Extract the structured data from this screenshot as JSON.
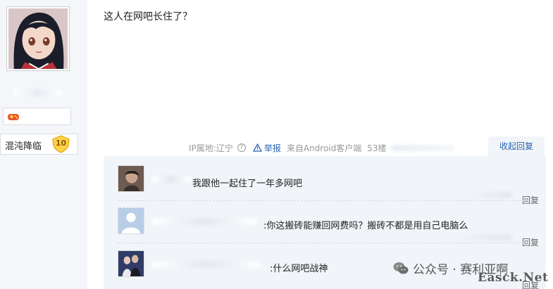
{
  "author": {
    "avatar_icon": "anime-girl-avatar-icon",
    "medal_icon": "game-controller-medal-icon",
    "level_name": "混沌降临",
    "level": "10"
  },
  "post": {
    "text": "这人在网吧长住了？",
    "ip_location": "IP属地:辽宁",
    "help_icon": "question-mark-icon",
    "report_label": "举报",
    "client": "来自Android客户端",
    "floor": "53楼",
    "collapse_reply_label": "收起回复"
  },
  "replies": [
    {
      "avatar_icon": "user-photo-avatar-icon",
      "text": "我跟他一起住了一年多网吧",
      "reply_label": "回复"
    },
    {
      "avatar_icon": "default-user-avatar-icon",
      "text": ":你这搬砖能赚回网费吗？搬砖不都是用自己电脑么",
      "reply_label": "回复"
    },
    {
      "avatar_icon": "couple-photo-avatar-icon",
      "text": ":什么网吧战神",
      "reply_label": "回复"
    }
  ],
  "watermark": {
    "icon": "wechat-icon",
    "text": "公众号 · 赛利亚啊",
    "corner_text": "Easck.Net"
  },
  "colors": {
    "link_blue": "#2d64b3",
    "reply_bg": "#f1f4f8",
    "sidebar_bg": "#f4f6f9"
  }
}
